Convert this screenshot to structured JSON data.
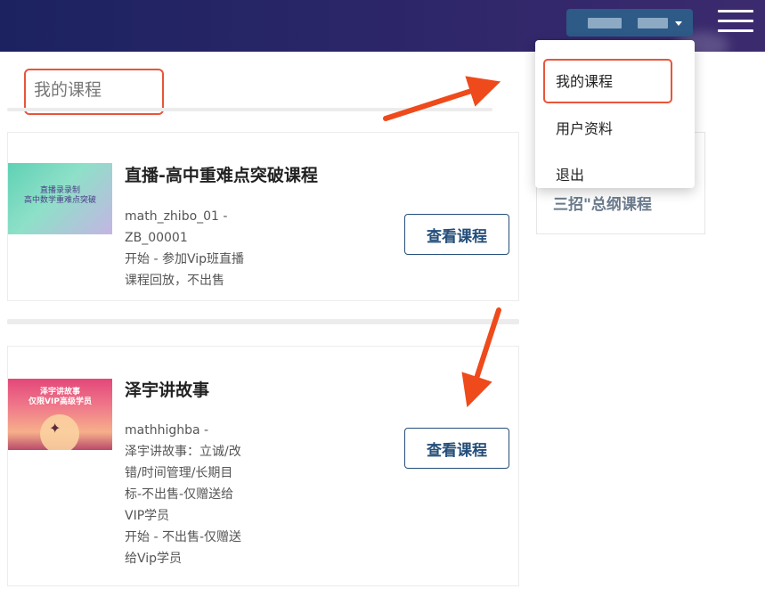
{
  "header": {
    "user_button": {
      "username_redacted": true
    },
    "menu_icon": "hamburger-icon"
  },
  "page": {
    "title": "我的课程"
  },
  "courses": [
    {
      "name": "直播-高中重难点突破课程",
      "thumbnail_text": "直播录录制\n高中数学重难点突破",
      "description_lines": [
        "math_zhibo_01 -",
        "ZB_00001",
        "开始 - 参加Vip班直播",
        "课程回放，不出售"
      ],
      "button": "查看课程"
    },
    {
      "name": "泽宇讲故事",
      "thumbnail_text": "泽宇讲故事\n仅限VIP高级学员",
      "description_lines": [
        "mathhighba -",
        "泽宇讲故事：立诚/改",
        "错/时间管理/长期目",
        "标-不出售-仅赠送给",
        "VIP学员",
        "开始 - 不出售-仅赠送",
        "给Vip学员"
      ],
      "button": "查看课程"
    }
  ],
  "side_card": {
    "title": "三招\"总纲课程"
  },
  "dropdown": {
    "items": [
      "我的课程",
      "用户资料",
      "退出"
    ]
  },
  "colors": {
    "header_start": "#1c2260",
    "header_end": "#3c2a6e",
    "user_button_bg": "#2d5a86",
    "button_border": "#244e7a",
    "annotation": "#e8553a"
  }
}
